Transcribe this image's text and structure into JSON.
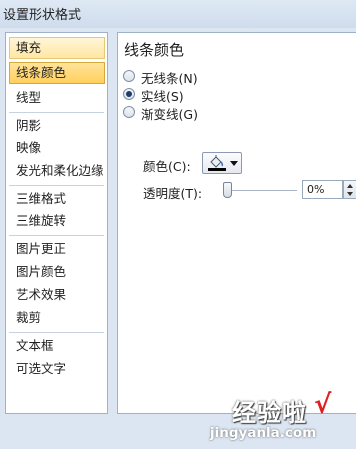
{
  "window": {
    "title": "设置形状格式"
  },
  "nav": {
    "items": [
      {
        "label": "填充"
      },
      {
        "label": "线条颜色"
      },
      {
        "label": "线型"
      },
      {
        "label": "阴影"
      },
      {
        "label": "映像"
      },
      {
        "label": "发光和柔化边缘"
      },
      {
        "label": "三维格式"
      },
      {
        "label": "三维旋转"
      },
      {
        "label": "图片更正"
      },
      {
        "label": "图片颜色"
      },
      {
        "label": "艺术效果"
      },
      {
        "label": "裁剪"
      },
      {
        "label": "文本框"
      },
      {
        "label": "可选文字"
      }
    ],
    "hovered": "填充",
    "selected": "线条颜色"
  },
  "panel": {
    "title": "线条颜色",
    "options": [
      {
        "label": "无线条(N)",
        "checked": false
      },
      {
        "label": "实线(S)",
        "checked": true
      },
      {
        "label": "渐变线(G)",
        "checked": false
      }
    ],
    "color_label": "颜色(C):",
    "transparency_label": "透明度(T):",
    "transparency_value": "0%",
    "transparency_percent": 0
  },
  "watermark": {
    "main": "经验啦",
    "check": "√",
    "url": "jingyanla.com"
  },
  "colors": {
    "accent_selected": "#ffd05c",
    "accent_hover": "#ffe7a2",
    "window_bg": "#dce6f2",
    "line_color_swatch": "#000000"
  },
  "icons": [
    "paint-bucket-icon",
    "dropdown-arrow-icon",
    "spin-up-icon",
    "spin-down-icon"
  ]
}
